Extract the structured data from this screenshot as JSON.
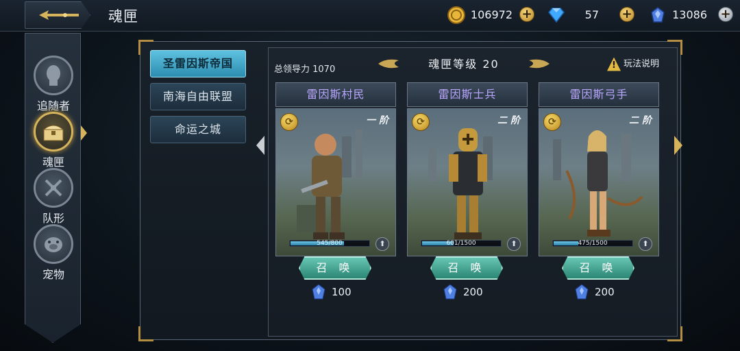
{
  "header": {
    "title": "魂匣",
    "back_icon": "back-arrow-icon"
  },
  "resources": [
    {
      "name": "gold",
      "icon": "gold-coin-icon",
      "value": "106972"
    },
    {
      "name": "diamond",
      "icon": "diamond-icon",
      "value": "57"
    },
    {
      "name": "soul-gem",
      "icon": "soul-gem-icon",
      "value": "13086"
    }
  ],
  "sidebar": {
    "items": [
      {
        "label": "追随者",
        "icon": "follower-head-icon",
        "active": false
      },
      {
        "label": "魂匣",
        "icon": "soul-box-icon",
        "active": true
      },
      {
        "label": "队形",
        "icon": "formation-swords-icon",
        "active": false
      },
      {
        "label": "宠物",
        "icon": "pet-pig-icon",
        "active": false
      }
    ]
  },
  "tabs": [
    {
      "label": "圣雷因斯帝国",
      "active": true
    },
    {
      "label": "南海自由联盟",
      "active": false
    },
    {
      "label": "命运之城",
      "active": false
    }
  ],
  "main": {
    "leadership": "总领导力 1070",
    "level_title": "魂匣等级 20",
    "help_label": "玩法说明"
  },
  "cards": [
    {
      "name": "雷因斯村民",
      "rank": "一 阶",
      "xp_text": "545/800",
      "xp_progress": 0.68,
      "summon_label": "召 唤",
      "cost": "100"
    },
    {
      "name": "雷因斯士兵",
      "rank": "二 阶",
      "xp_text": "601/1500",
      "xp_progress": 0.4,
      "summon_label": "召 唤",
      "cost": "200"
    },
    {
      "name": "雷因斯弓手",
      "rank": "二 阶",
      "xp_text": "475/1500",
      "xp_progress": 0.32,
      "summon_label": "召 唤",
      "cost": "200"
    }
  ],
  "colors": {
    "accent_gold": "#d6b45c",
    "tab_active": "#5fc1e0",
    "card_name": "#b9a6ff",
    "summon_button": "#2c8674"
  }
}
